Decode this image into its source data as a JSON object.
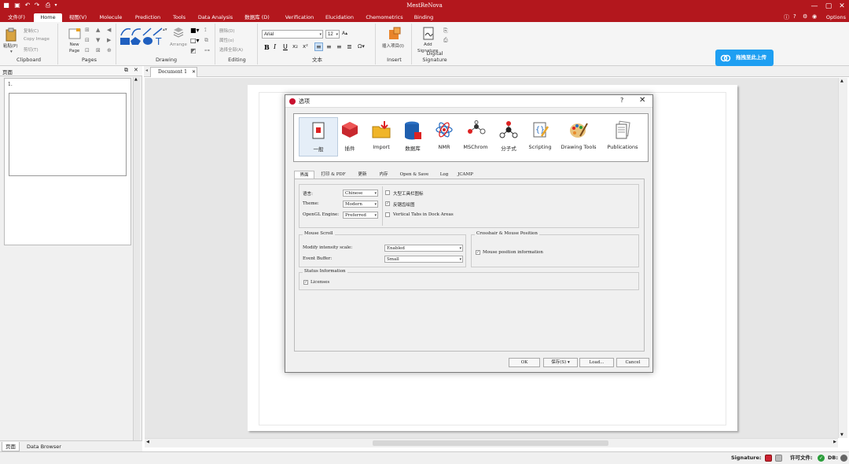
{
  "window": {
    "title": "MestReNova"
  },
  "colors": {
    "brand": "#b3171d",
    "upload": "#1e9ff2",
    "ok_green": "#2a9d3a"
  },
  "menu": {
    "tabs": [
      "文件(F)",
      "Home",
      "视图(V)",
      "Molecule",
      "Prediction",
      "Tools",
      "Data Analysis",
      "数据库 (D)",
      "Verification",
      "Elucidation",
      "Chemometrics",
      "Binding"
    ],
    "options": "Options"
  },
  "ribbon": {
    "clipboard": {
      "paste": "粘贴(P)",
      "copy": "复制(C)",
      "copy_image": "Copy Image",
      "cut": "剪切(T)",
      "label": "Clipboard"
    },
    "pages": {
      "new_page": "New\nPage",
      "label": "Pages"
    },
    "drawing": {
      "arrange": "Arrange",
      "label": "Drawing"
    },
    "editing": {
      "delete": "删除(D)",
      "properties": "属性(o)",
      "select_all": "选择全部(A)",
      "label": "Editing"
    },
    "text": {
      "font": "Arial",
      "size": "12",
      "bold": "B",
      "italic": "I",
      "underline": "U",
      "label": "文本"
    },
    "insert": {
      "insert_item": "插入项目(I)",
      "label": "Insert"
    },
    "signature": {
      "add": "Add\nSignature",
      "label": "Digital Signature"
    }
  },
  "upload_button": "拖拽至此上传",
  "left_panel": {
    "title": "页面",
    "page_number": "1.",
    "tabs": [
      "页面",
      "Data Browser"
    ]
  },
  "document_tab": "Document 1",
  "dialog": {
    "title": "选项",
    "help": "?",
    "close": "✕",
    "categories": [
      "一般",
      "插件",
      "Import",
      "数据库",
      "NMR",
      "MSChrom",
      "分子式",
      "Scripting",
      "Drawing Tools",
      "Publications"
    ],
    "tabs": [
      "界面",
      "打印 & PDF",
      "更新",
      "内存",
      "Open & Save",
      "Log",
      "JCAMP"
    ],
    "general": {
      "language_label": "语言:",
      "language_value": "Chinese",
      "theme_label": "Theme:",
      "theme_value": "Modern",
      "opengl_label": "OpenGL Engine:",
      "opengl_value": "Preferred",
      "large_toolbar_icons": "大型工具栏图标",
      "antialias": "反锯齿绘图",
      "vertical_tabs": "Vertical Tabs in Dock Areas"
    },
    "mouse_scroll": {
      "title": "Mouse Scroll",
      "modify_label": "Modify intensity scale:",
      "modify_value": "Enabled",
      "event_label": "Event Buffer:",
      "event_value": "Small"
    },
    "crosshair": {
      "title": "Crosshair & Mouse Position",
      "mouse_position": "Mouse position information"
    },
    "status_info": {
      "title": "Status Information",
      "licenses": "Licenses"
    },
    "buttons": {
      "ok": "OK",
      "save": "保存(S)",
      "load": "Load...",
      "cancel": "Cancel"
    }
  },
  "status": {
    "signature": "Signature:",
    "license": "许可文件:",
    "db": "DB:"
  }
}
